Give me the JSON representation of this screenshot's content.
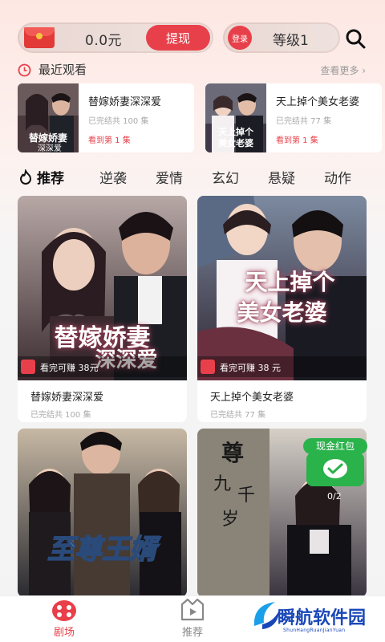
{
  "header": {
    "balance": "0.0元",
    "withdraw_label": "提现",
    "login_label": "登录",
    "level_label": "等级1"
  },
  "recent": {
    "title": "最近观看",
    "more_label": "查看更多",
    "items": [
      {
        "title": "替嫁娇妻深深爱",
        "meta": "已完结共 100 集",
        "progress": "看到第 1 集"
      },
      {
        "title": "天上掉个美女老婆",
        "meta": "已完结共 77 集",
        "progress": "看到第 1 集"
      }
    ]
  },
  "tabs": [
    "推荐",
    "逆袭",
    "爱情",
    "玄幻",
    "悬疑",
    "动作"
  ],
  "grid": [
    {
      "title": "替嫁娇妻深深爱",
      "meta": "已完结共 100 集",
      "earn": "看完可赚 38元"
    },
    {
      "title": "天上掉个美女老婆",
      "meta": "已完结共 77 集",
      "earn": "看完可赚 38 元"
    },
    {
      "title": "",
      "meta": "",
      "earn": ""
    },
    {
      "title": "",
      "meta": "",
      "earn": ""
    }
  ],
  "cash_float": {
    "label": "现金红包",
    "counter": "0/2"
  },
  "nav": [
    {
      "label": "剧场",
      "active": true
    },
    {
      "label": "推荐",
      "active": false
    }
  ],
  "watermark": {
    "text": "瞬航软件园",
    "sub": "ShunHangRuanJianYuan"
  },
  "colors": {
    "accent": "#e8404a",
    "cash_green": "#2ab24b"
  }
}
